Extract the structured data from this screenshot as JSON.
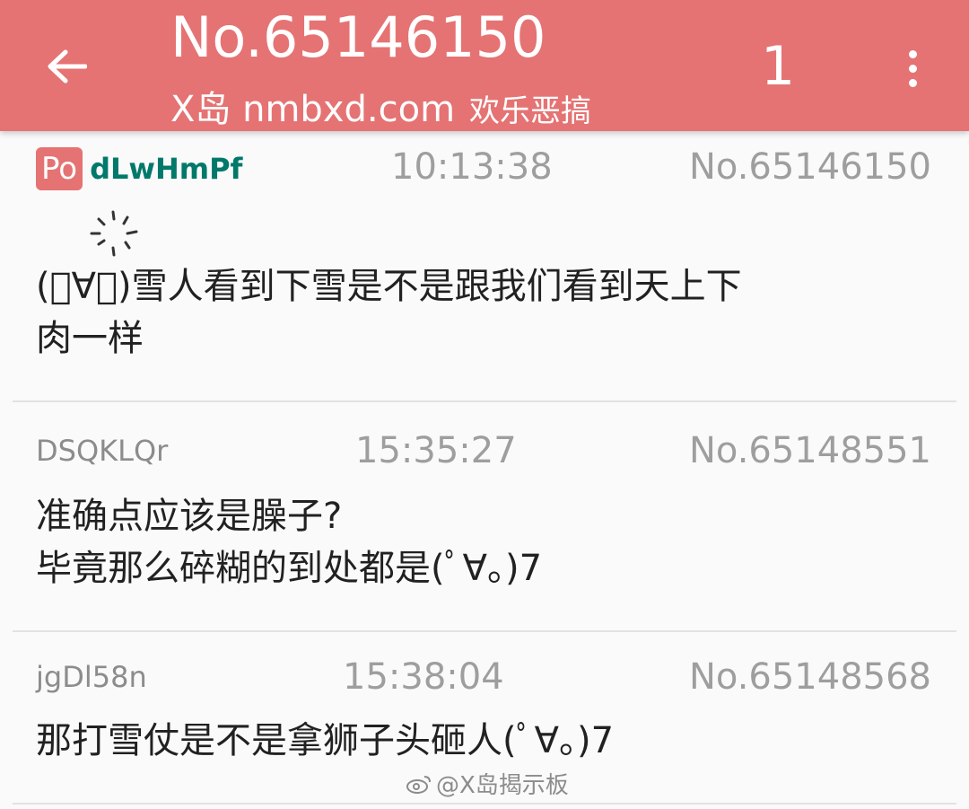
{
  "appbar": {
    "title": "No.65146150",
    "subtitle": "X岛 nmbxd.com",
    "subtitle_cn": "欢乐恶搞",
    "page_number": "1"
  },
  "posts": [
    {
      "is_po": true,
      "po_label": "Po",
      "uid": "dLwHmPf",
      "time": "10:13:38",
      "no": "No.65146150",
      "content": "(ﾟ∀。)雪人看到下雪是不是跟我们看到天上下\n肉一样"
    },
    {
      "uid": "DSQKLQr",
      "time": "15:35:27",
      "no": "No.65148551",
      "content": "准确点应该是臊子?\n毕竟那么碎糊的到处都是(ﾟ∀。)7"
    },
    {
      "uid": "jgDl58n",
      "time": "15:38:04",
      "no": "No.65148568",
      "content": "那打雪仗是不是拿狮子头砸人(ﾟ∀。)7"
    }
  ],
  "watermark": "@X岛揭示板",
  "colors": {
    "accent": "#e57373",
    "po_uid": "#00796b",
    "meta": "#9e9e9e"
  },
  "icons": [
    "back-arrow-icon",
    "more-vert-icon",
    "sparkle-icon",
    "weibo-icon"
  ]
}
